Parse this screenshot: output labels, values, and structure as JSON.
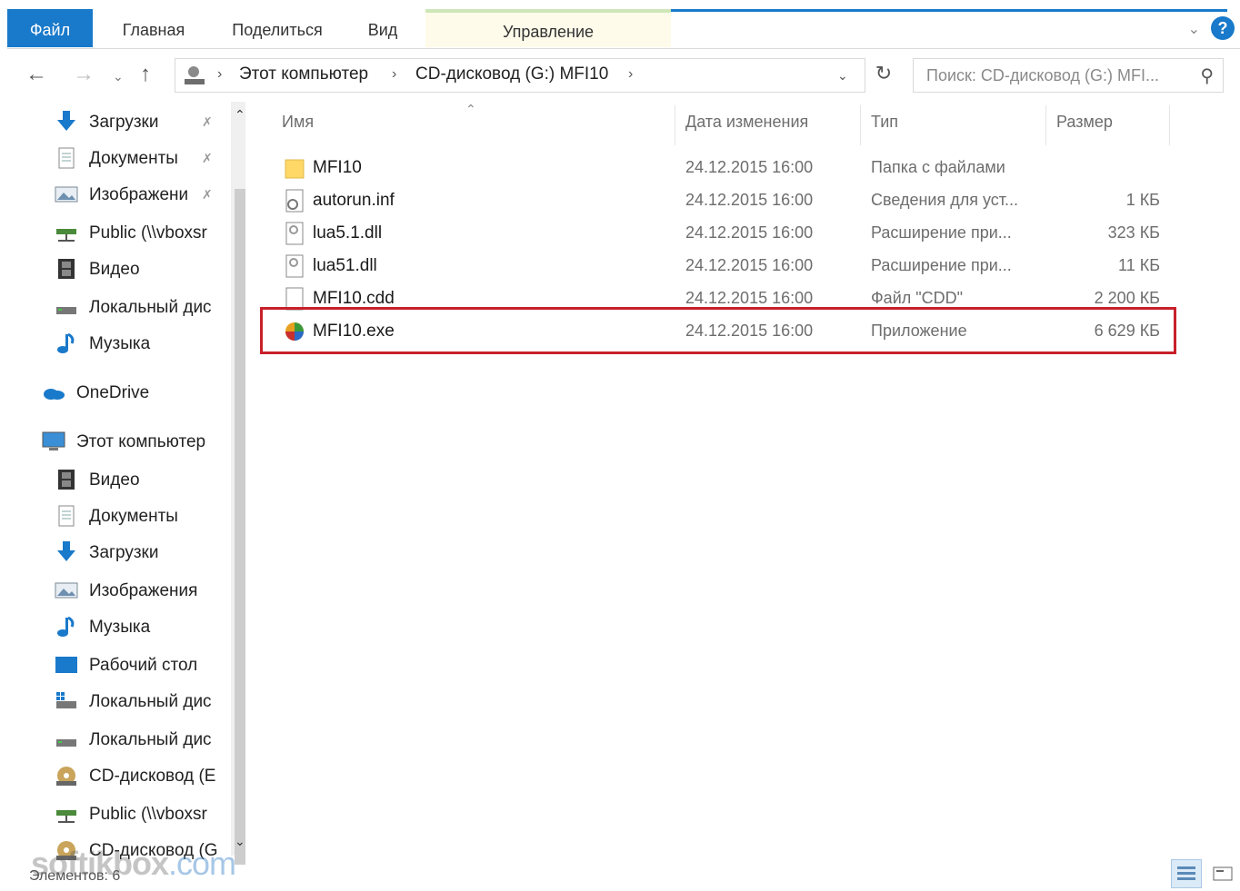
{
  "ribbon": {
    "tabs": [
      "Файл",
      "Главная",
      "Поделиться",
      "Вид",
      "Управление"
    ]
  },
  "address": {
    "crumbs": [
      "Этот компьютер",
      "CD-дисковод (G:) MFI10"
    ],
    "search_placeholder": "Поиск: CD-дисковод (G:) MFI..."
  },
  "sidebar": {
    "items": [
      {
        "label": "Загрузки",
        "icon": "download-icon",
        "pinned": true
      },
      {
        "label": "Документы",
        "icon": "documents-icon",
        "pinned": true
      },
      {
        "label": "Изображени",
        "icon": "pictures-icon",
        "pinned": true
      },
      {
        "label": "Public (\\\\vboxsr",
        "icon": "network-drive-icon",
        "pinned": false
      },
      {
        "label": "Видео",
        "icon": "video-icon",
        "pinned": false
      },
      {
        "label": "Локальный дис",
        "icon": "drive-icon",
        "pinned": false
      },
      {
        "label": "Музыка",
        "icon": "music-icon",
        "pinned": false
      },
      {
        "label": "OneDrive",
        "icon": "onedrive-icon",
        "pinned": false
      },
      {
        "label": "Этот компьютер",
        "icon": "computer-icon",
        "pinned": false
      },
      {
        "label": "Видео",
        "icon": "video-icon",
        "pinned": false
      },
      {
        "label": "Документы",
        "icon": "documents-icon",
        "pinned": false
      },
      {
        "label": "Загрузки",
        "icon": "download-icon",
        "pinned": false
      },
      {
        "label": "Изображения",
        "icon": "pictures-icon",
        "pinned": false
      },
      {
        "label": "Музыка",
        "icon": "music-icon",
        "pinned": false
      },
      {
        "label": "Рабочий стол",
        "icon": "desktop-icon",
        "pinned": false
      },
      {
        "label": "Локальный дис",
        "icon": "system-drive-icon",
        "pinned": false
      },
      {
        "label": "Локальный дис",
        "icon": "drive-icon",
        "pinned": false
      },
      {
        "label": "CD-дисковод (E",
        "icon": "cd-drive-icon",
        "pinned": false
      },
      {
        "label": "Public (\\\\vboxsr",
        "icon": "network-drive-icon",
        "pinned": false
      },
      {
        "label": "CD-дисковод (G",
        "icon": "cd-drive-icon",
        "pinned": false
      }
    ]
  },
  "columns": [
    "Имя",
    "Дата изменения",
    "Тип",
    "Размер"
  ],
  "files": [
    {
      "name": "MFI10",
      "date": "24.12.2015 16:00",
      "type": "Папка с файлами",
      "size": "",
      "icon": "folder-icon"
    },
    {
      "name": "autorun.inf",
      "date": "24.12.2015 16:00",
      "type": "Сведения для уст...",
      "size": "1 КБ",
      "icon": "settings-file-icon"
    },
    {
      "name": "lua5.1.dll",
      "date": "24.12.2015 16:00",
      "type": "Расширение при...",
      "size": "323 КБ",
      "icon": "dll-file-icon"
    },
    {
      "name": "lua51.dll",
      "date": "24.12.2015 16:00",
      "type": "Расширение при...",
      "size": "11 КБ",
      "icon": "dll-file-icon"
    },
    {
      "name": "MFI10.cdd",
      "date": "24.12.2015 16:00",
      "type": "Файл \"CDD\"",
      "size": "2 200 КБ",
      "icon": "blank-file-icon"
    },
    {
      "name": "MFI10.exe",
      "date": "24.12.2015 16:00",
      "type": "Приложение",
      "size": "6 629 КБ",
      "icon": "app-icon"
    }
  ],
  "status": {
    "items_count": "Элементов: 6"
  },
  "watermark": {
    "brand": "softikbox",
    "tld": ".com"
  },
  "colors": {
    "accent": "#1979ca",
    "highlight_border": "#c8202a"
  }
}
